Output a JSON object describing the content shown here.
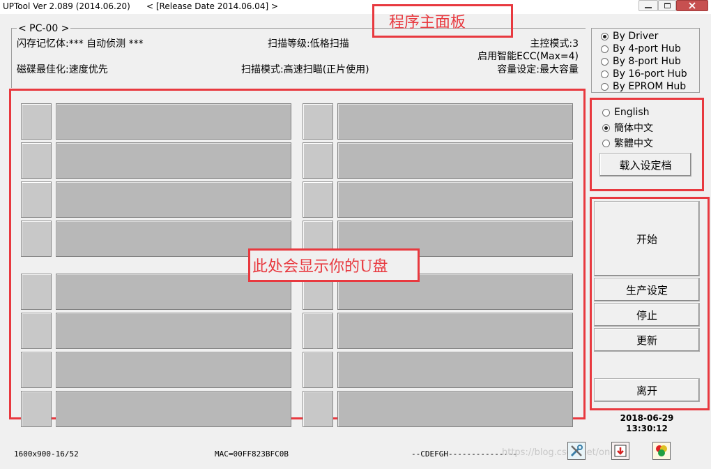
{
  "window": {
    "title": "UPTool Ver 2.089 (2014.06.20)",
    "release": "< [Release Date 2014.06.04] >",
    "minimize_icon": "minimize-icon",
    "maximize_icon": "maximize-icon",
    "close_icon": "close-icon"
  },
  "annotations": {
    "main_panel": "程序主面板",
    "udisk_area": "此处会显示你的U盘"
  },
  "info": {
    "group_title": "< PC-00 >",
    "flash_memory": "闪存记忆体:*** 自动侦测 ***",
    "scan_level": "扫描等级:低格扫描",
    "controller_mode": "主控模式:3",
    "ecc": "启用智能ECC(Max=4)",
    "disk_optimize": "磁碟最佳化:速度优先",
    "scan_mode": "扫描模式:高速扫瞄(正片使用)",
    "capacity": "容量设定:最大容量"
  },
  "hub_modes": {
    "options": [
      "By Driver",
      "By 4-port Hub",
      "By 8-port Hub",
      "By 16-port Hub",
      "By EPROM Hub"
    ],
    "selected": 0
  },
  "languages": {
    "options": [
      "English",
      "簡体中文",
      "繁體中文"
    ],
    "selected": 1,
    "load_config_label": "载入设定档"
  },
  "actions": {
    "start": "开始",
    "production_settings": "生产设定",
    "stop": "停止",
    "update": "更新",
    "exit": "离开"
  },
  "clock": {
    "date": "2018-06-29",
    "time": "13:30:12"
  },
  "statusbar": {
    "resolution": "1600x900-16/52",
    "mac": "MAC=00FF823BFC0B",
    "drives": "--CDEFGH---------------",
    "watermark": "https://blog.csdn.net/ongrez",
    "tool_icons": [
      "tools-icon",
      "download-icon",
      "color-balls-icon"
    ]
  }
}
